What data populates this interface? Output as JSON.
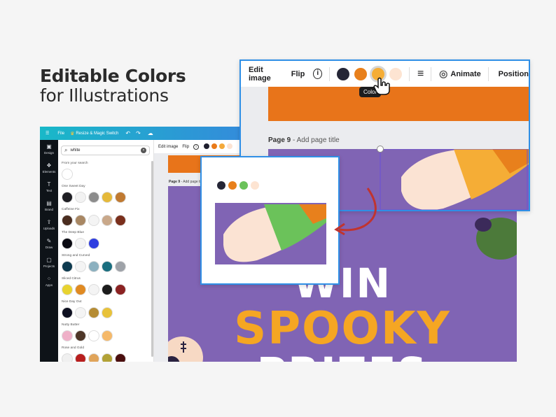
{
  "headline": {
    "line1": "Editable Colors",
    "line2": "for Illustrations"
  },
  "editor": {
    "topbar": {
      "menu_icon": "☰",
      "file": "File",
      "resize": "Resize & Magic Switch",
      "undo": "↶",
      "redo": "↷",
      "cloud": "☁"
    },
    "rail": [
      {
        "icon": "▣",
        "label": "Design"
      },
      {
        "icon": "❖",
        "label": "Elements"
      },
      {
        "icon": "T",
        "label": "Text"
      },
      {
        "icon": "▤",
        "label": "Brand"
      },
      {
        "icon": "⇪",
        "label": "Uploads"
      },
      {
        "icon": "✎",
        "label": "Draw"
      },
      {
        "icon": "▢",
        "label": "Projects"
      },
      {
        "icon": "⁘",
        "label": "Apps"
      }
    ],
    "search": {
      "value": "white",
      "icon": "⌕",
      "clear": "×"
    },
    "groups": [
      {
        "name": "From your search",
        "colors": [
          "#ffffff"
        ]
      },
      {
        "name": "One Sweet Day",
        "colors": [
          "#1f1f24",
          "#f2f2f2",
          "#8c8c8c",
          "#e5b93a",
          "#c07a31"
        ]
      },
      {
        "name": "Caffeine Fix",
        "colors": [
          "#4a2d1f",
          "#a88763",
          "#f4f4f4",
          "#c9a88a",
          "#7a2f1c"
        ]
      },
      {
        "name": "The Deep Blue",
        "colors": [
          "#0a0a12",
          "#f4f4f4",
          "#2f3ee0"
        ]
      },
      {
        "name": "Strong and Curved",
        "colors": [
          "#0e3a4f",
          "#f4f4f4",
          "#8bb0bf",
          "#1a6e7f",
          "#9ea2a8"
        ]
      },
      {
        "name": "Sliced Citrus",
        "colors": [
          "#e8d330",
          "#e08a22",
          "#f4f4f4",
          "#1c1c1c",
          "#8b2222"
        ]
      },
      {
        "name": "Nice Day Out",
        "colors": [
          "#0e1020",
          "#f4f4f4",
          "#b58c34",
          "#e8c23a"
        ]
      },
      {
        "name": "Nutty Butter",
        "colors": [
          "#efb0c8",
          "#4e3628",
          "#ffffff",
          "#f5b96a"
        ]
      },
      {
        "name": "Rose and Gold",
        "colors": [
          "#f0f0f0",
          "#b81e1e",
          "#e0a45a",
          "#b2a236",
          "#4a0e0e"
        ]
      }
    ],
    "mini_toolbar": {
      "edit": "Edit image",
      "flip": "Flip",
      "info": "i",
      "dots": [
        "#1f1f2e",
        "#e97a1a",
        "#f4a93a",
        "#fbe3d3"
      ]
    },
    "page": {
      "label": "Page 9",
      "add_title": "- Add page title"
    },
    "poster": {
      "line1": "WIN",
      "line2": "SPOOKY",
      "line3": "PRIZES"
    },
    "magic": "✦"
  },
  "zoom_top": {
    "edit": "Edit image",
    "flip": "Flip",
    "info": "i",
    "dots": [
      "#252636",
      "#e8801c",
      "#f5ad36",
      "#fde4d2"
    ],
    "align_icon": "≡",
    "animate_icon": "◎",
    "animate": "Animate",
    "position": "Position",
    "tooltip": "Color",
    "page_label": "Page 9",
    "page_add": "- Add page title"
  },
  "zoom_left": {
    "dots": [
      "#252636",
      "#e8801c",
      "#6bc25a",
      "#fde4d2"
    ]
  },
  "colors": {
    "accent": "#2f8fe6",
    "purple": "#8064b4",
    "orange": "#e8741a",
    "arrow": "#c0342f"
  }
}
